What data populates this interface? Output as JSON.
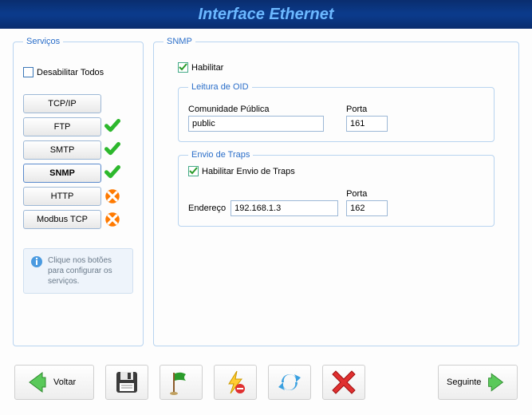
{
  "title": "Interface Ethernet",
  "services": {
    "legend": "Serviços",
    "disable_all": "Desabilitar Todos",
    "items": [
      {
        "label": "TCP/IP",
        "status": "none",
        "active": false
      },
      {
        "label": "FTP",
        "status": "ok",
        "active": false
      },
      {
        "label": "SMTP",
        "status": "ok",
        "active": false
      },
      {
        "label": "SNMP",
        "status": "ok",
        "active": true
      },
      {
        "label": "HTTP",
        "status": "err",
        "active": false
      },
      {
        "label": "Modbus TCP",
        "status": "err",
        "active": false
      }
    ],
    "info": "Clique nos botões para configurar os serviços."
  },
  "snmp": {
    "legend": "SNMP",
    "enable_label": "Habilitar",
    "enable_checked": true,
    "oid": {
      "legend": "Leitura de OID",
      "community_label": "Comunidade Pública",
      "community_value": "public",
      "port_label": "Porta",
      "port_value": "161"
    },
    "traps": {
      "legend": "Envio de Traps",
      "enable_label": "Habilitar Envio de Traps",
      "enable_checked": true,
      "address_label": "Endereço",
      "address_value": "192.168.1.3",
      "port_label": "Porta",
      "port_value": "162"
    }
  },
  "toolbar": {
    "back": "Voltar",
    "next": "Seguinte"
  }
}
